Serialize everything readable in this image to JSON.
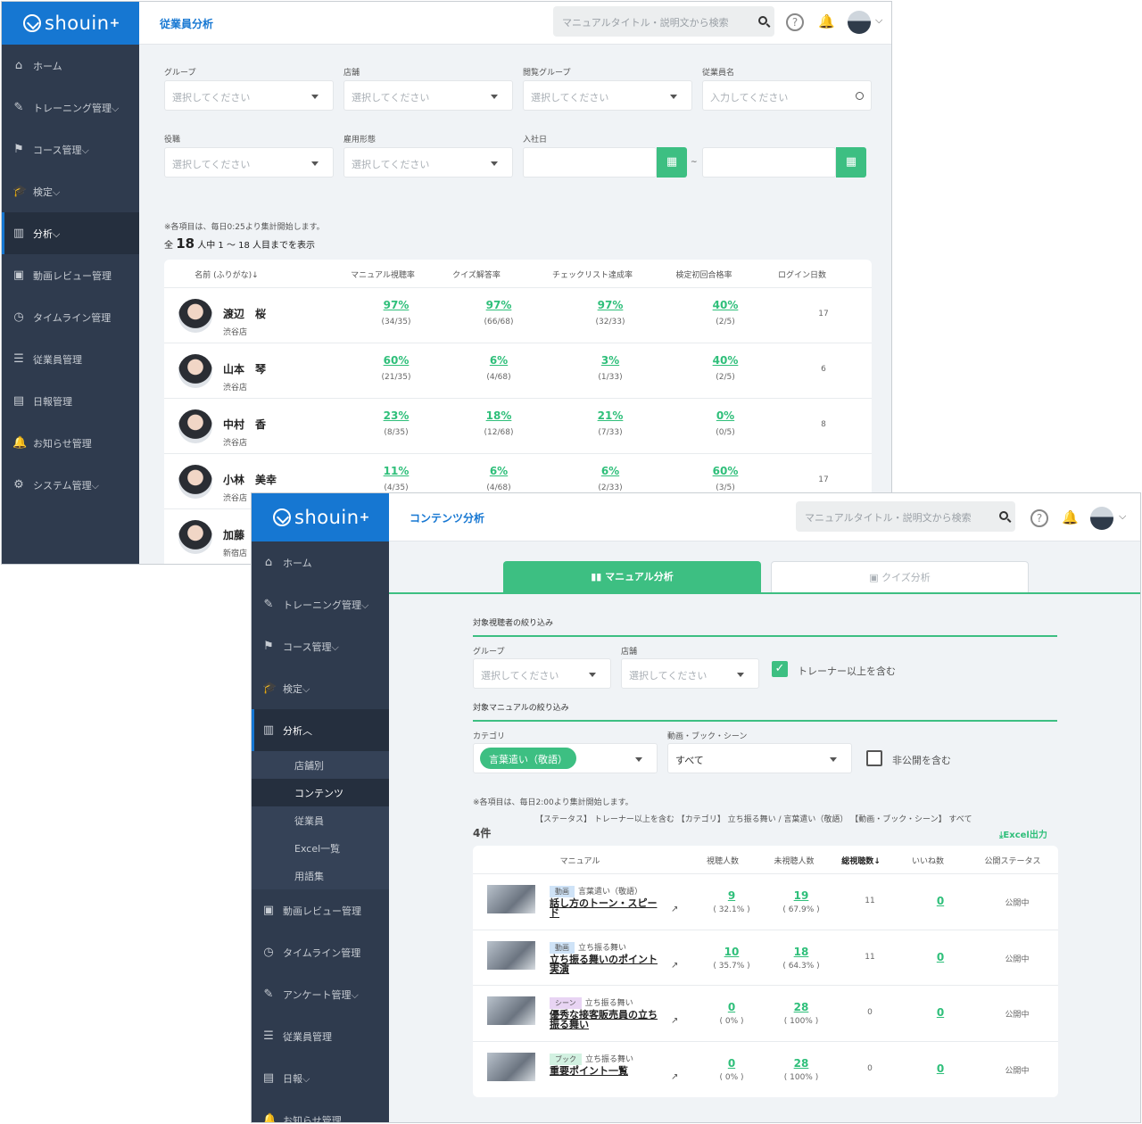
{
  "w1": {
    "logo": "shouin",
    "logo_plus": "+",
    "title": "従業員分析",
    "search_placeholder": "マニュアルタイトル・説明文から検索",
    "help": "?",
    "sidebar": [
      {
        "label": "ホーム",
        "icon": "home-icon",
        "glyph": "⌂"
      },
      {
        "label": "トレーニング管理⌵",
        "icon": "edit-icon",
        "glyph": "✎"
      },
      {
        "label": "コース管理⌵",
        "icon": "flag-icon",
        "glyph": "⚑"
      },
      {
        "label": "検定⌵",
        "icon": "graduation-cap-icon",
        "glyph": "🎓"
      },
      {
        "label": "分析⌵",
        "icon": "chart-icon",
        "glyph": "▥"
      },
      {
        "label": "動画レビュー管理",
        "icon": "video-icon",
        "glyph": "▣"
      },
      {
        "label": "タイムライン管理",
        "icon": "clock-icon",
        "glyph": "◷"
      },
      {
        "label": "従業員管理",
        "icon": "list-icon",
        "glyph": "☰"
      },
      {
        "label": "日報管理",
        "icon": "report-icon",
        "glyph": "▤"
      },
      {
        "label": "お知らせ管理",
        "icon": "bell-icon",
        "glyph": "🔔"
      },
      {
        "label": "システム管理⌵",
        "icon": "gear-icon",
        "glyph": "⚙"
      }
    ],
    "filters": {
      "group": {
        "label": "グループ",
        "value": "選択してください"
      },
      "store": {
        "label": "店舗",
        "value": "選択してください"
      },
      "view_group": {
        "label": "閲覧グループ",
        "value": "選択してください"
      },
      "employee": {
        "label": "従業員名",
        "value": "入力してください"
      },
      "role": {
        "label": "役職",
        "value": "選択してください"
      },
      "employment": {
        "label": "雇用形態",
        "value": "選択してください"
      },
      "join_date": {
        "label": "入社日",
        "sep": "~"
      }
    },
    "note": "※各項目は、毎日0:25より集計開始します。",
    "count_prefix": "全",
    "count": "18",
    "count_suffix": "人中 1 ～ 18 人目までを表示",
    "headers": [
      "名前 (ふりがな)↓",
      "マニュアル視聴率",
      "クイズ解答率",
      "チェックリスト達成率",
      "検定初回合格率",
      "ログイン日数"
    ],
    "rows": [
      {
        "name": "渡辺　桜",
        "shop": "渋谷店",
        "m": "97%",
        "mf": "(34/35)",
        "q": "97%",
        "qf": "(66/68)",
        "c": "97%",
        "cf": "(32/33)",
        "e": "40%",
        "ef": "(2/5)",
        "login": "17"
      },
      {
        "name": "山本　琴",
        "shop": "渋谷店",
        "m": "60%",
        "mf": "(21/35)",
        "q": "6%",
        "qf": "(4/68)",
        "c": "3%",
        "cf": "(1/33)",
        "e": "40%",
        "ef": "(2/5)",
        "login": "6"
      },
      {
        "name": "中村　香",
        "shop": "渋谷店",
        "m": "23%",
        "mf": "(8/35)",
        "q": "18%",
        "qf": "(12/68)",
        "c": "21%",
        "cf": "(7/33)",
        "e": "0%",
        "ef": "(0/5)",
        "login": "8"
      },
      {
        "name": "小林　美幸",
        "shop": "渋谷店",
        "m": "11%",
        "mf": "(4/35)",
        "q": "6%",
        "qf": "(4/68)",
        "c": "6%",
        "cf": "(2/33)",
        "e": "60%",
        "ef": "(3/5)",
        "login": "17"
      },
      {
        "name": "加藤",
        "shop": "新宿店",
        "m": "",
        "mf": "",
        "q": "",
        "qf": "",
        "c": "",
        "cf": "",
        "e": "",
        "ef": "",
        "login": ""
      }
    ]
  },
  "w2": {
    "logo": "shouin",
    "logo_plus": "+",
    "title": "コンテンツ分析",
    "search_placeholder": "マニュアルタイトル・説明文から検索",
    "help": "?",
    "sidebar_top": [
      {
        "label": "ホーム",
        "icon": "home-icon",
        "glyph": "⌂"
      },
      {
        "label": "トレーニング管理⌵",
        "icon": "edit-icon",
        "glyph": "✎"
      },
      {
        "label": "コース管理⌵",
        "icon": "flag-icon",
        "glyph": "⚑"
      },
      {
        "label": "検定⌵",
        "icon": "graduation-cap-icon",
        "glyph": "🎓"
      },
      {
        "label": "分析︿",
        "icon": "chart-icon",
        "glyph": "▥"
      }
    ],
    "sidebar_sub": [
      "店舗別",
      "コンテンツ",
      "従業員",
      "Excel一覧",
      "用語集"
    ],
    "sidebar_bottom": [
      {
        "label": "動画レビュー管理",
        "icon": "video-icon",
        "glyph": "▣"
      },
      {
        "label": "タイムライン管理",
        "icon": "clock-icon",
        "glyph": "◷"
      },
      {
        "label": "アンケート管理⌵",
        "icon": "survey-icon",
        "glyph": "✎"
      },
      {
        "label": "従業員管理",
        "icon": "list-icon",
        "glyph": "☰"
      },
      {
        "label": "日報⌵",
        "icon": "report-icon",
        "glyph": "▤"
      },
      {
        "label": "お知らせ管理",
        "icon": "bell-icon",
        "glyph": "🔔"
      }
    ],
    "tabs": {
      "manual": "マニュアル分析",
      "quiz": "クイズ分析"
    },
    "sect_viewer": "対象視聴者の絞り込み",
    "group": {
      "label": "グループ",
      "value": "選択してください"
    },
    "store": {
      "label": "店舗",
      "value": "選択してください"
    },
    "trainer_check": "トレーナー以上を含む",
    "sect_manual": "対象マニュアルの絞り込み",
    "category": {
      "label": "カテゴリ",
      "value": "言葉遣い（敬語）"
    },
    "media": {
      "label": "動画・ブック・シーン",
      "value": "すべて"
    },
    "private_check": "非公開を含む",
    "note": "※各項目は、毎日2:00より集計開始します。",
    "count": "4件",
    "conditions": "【ステータス】 トレーナー以上を含む 【カテゴリ】 立ち振る舞い / 言葉遣い（敬語） 【動画・ブック・シーン】 すべて",
    "excel": "Excel出力",
    "headers": [
      "マニュアル",
      "視聴人数",
      "未視聴人数",
      "総視聴数↓",
      "いいね数",
      "公開ステータス"
    ],
    "rows": [
      {
        "type": "動画",
        "cat": "言葉遣い（敬語）",
        "title": "話し方のトーン・スピード",
        "v": "9",
        "vp": "( 32.1% )",
        "u": "19",
        "up": "( 67.9% )",
        "total": "11",
        "likes": "0",
        "status": "公開中"
      },
      {
        "type": "動画",
        "cat": "立ち振る舞い",
        "title": "立ち振る舞いのポイント実演",
        "v": "10",
        "vp": "( 35.7% )",
        "u": "18",
        "up": "( 64.3% )",
        "total": "11",
        "likes": "0",
        "status": "公開中"
      },
      {
        "type": "シーン",
        "cat": "立ち振る舞い",
        "title": "優秀な接客販売員の立ち振る舞い",
        "v": "0",
        "vp": "( 0% )",
        "u": "28",
        "up": "( 100% )",
        "total": "0",
        "likes": "0",
        "status": "公開中"
      },
      {
        "type": "ブック",
        "cat": "立ち振る舞い",
        "title": "重要ポイント一覧",
        "v": "0",
        "vp": "( 0% )",
        "u": "28",
        "up": "( 100% )",
        "total": "0",
        "likes": "0",
        "status": "公開中"
      }
    ],
    "tag_colors": {
      "動画": "#cfe3f7",
      "シーン": "#e8d4f3",
      "ブック": "#d2f1e1"
    }
  },
  "colors": {
    "brand": "#1677d2",
    "accent": "#3dbf82",
    "sidebar": "#2f3b4e"
  }
}
